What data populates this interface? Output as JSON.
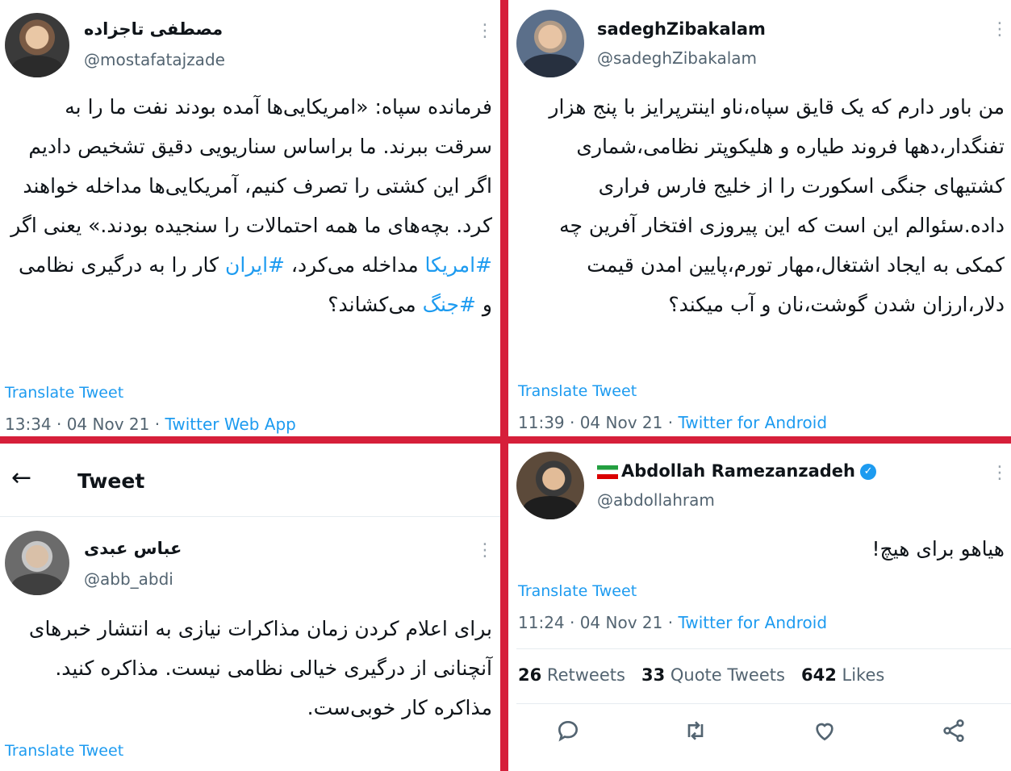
{
  "tweets": {
    "tajzade": {
      "name": "مصطفی تاجزاده",
      "handle": "@mostafatajzade",
      "body_parts": [
        {
          "text": "فرمانده سپاه: «امریکایی‌ها آمده بودند نفت ما را به سرقت ببرند. ما براساس سناریویی دقیق تشخیص دادیم اگر این کشتی را تصرف کنیم، آمریکایی‌ها مداخله خواهند کرد. بچه‌های ما همه احتمالات را سنجیده بودند.» یعنی اگر ",
          "tag": false
        },
        {
          "text": "#امریکا",
          "tag": true
        },
        {
          "text": " مداخله می‌کرد، ",
          "tag": false
        },
        {
          "text": "#ایران",
          "tag": true
        },
        {
          "text": " کار را به درگیری نظامی و ",
          "tag": false
        },
        {
          "text": "#جنگ",
          "tag": true
        },
        {
          "text": " می‌کشاند؟",
          "tag": false
        }
      ],
      "translate": "Translate Tweet",
      "time": "13:34 · 04 Nov 21 · ",
      "source": "Twitter Web App"
    },
    "zibakalam": {
      "name": "sadeghZibakalam",
      "handle": "@sadeghZibakalam",
      "body": "من باور دارم که یک قایق سپاه،ناو اینترپرایز با پنج هزار تفنگدار،دهها فروند طیاره و هلیکوپتر نظامی،شماری کشتیهای جنگی اسکورت را از خلیج فارس فراری داده.سئوالم این است که این پیروزی افتخار آفرین چه کمکی به ایجاد اشتغال،مهار تورم،پایین امدن قیمت دلار،ارزان شدن گوشت،نان و آب میکند؟",
      "translate": "Translate Tweet",
      "time": "11:39 · 04 Nov 21 · ",
      "source": "Twitter for Android"
    },
    "abdi": {
      "header_title": "Tweet",
      "name": "عباس عبدی",
      "handle": "@abb_abdi",
      "body": "برای اعلام کردن زمان مذاکرات نیازی به انتشار خبرهای آنچنانی از درگیری خیالی نظامی نیست. مذاکره کنید. مذاکره کار خوبی‌ست.",
      "translate": "Translate Tweet"
    },
    "ramezanzadeh": {
      "name": "Abdollah Ramezanzadeh",
      "handle": "@abdollahram",
      "body": "هیاهو برای هیچ!",
      "translate": "Translate Tweet",
      "time": "11:24 · 04 Nov 21 · ",
      "source": "Twitter for Android",
      "stats": {
        "retweets_count": "26",
        "retweets_label": "Retweets",
        "quotes_count": "33",
        "quotes_label": "Quote Tweets",
        "likes_count": "642",
        "likes_label": "Likes"
      }
    }
  },
  "colors": {
    "divider": "#d61f3a",
    "link": "#1d9bf0",
    "muted": "#536471"
  },
  "icons": [
    "back-arrow-icon",
    "more-dots-icon",
    "verified-badge-icon",
    "iran-flag-icon",
    "reply-icon",
    "retweet-icon",
    "like-icon",
    "share-icon"
  ]
}
